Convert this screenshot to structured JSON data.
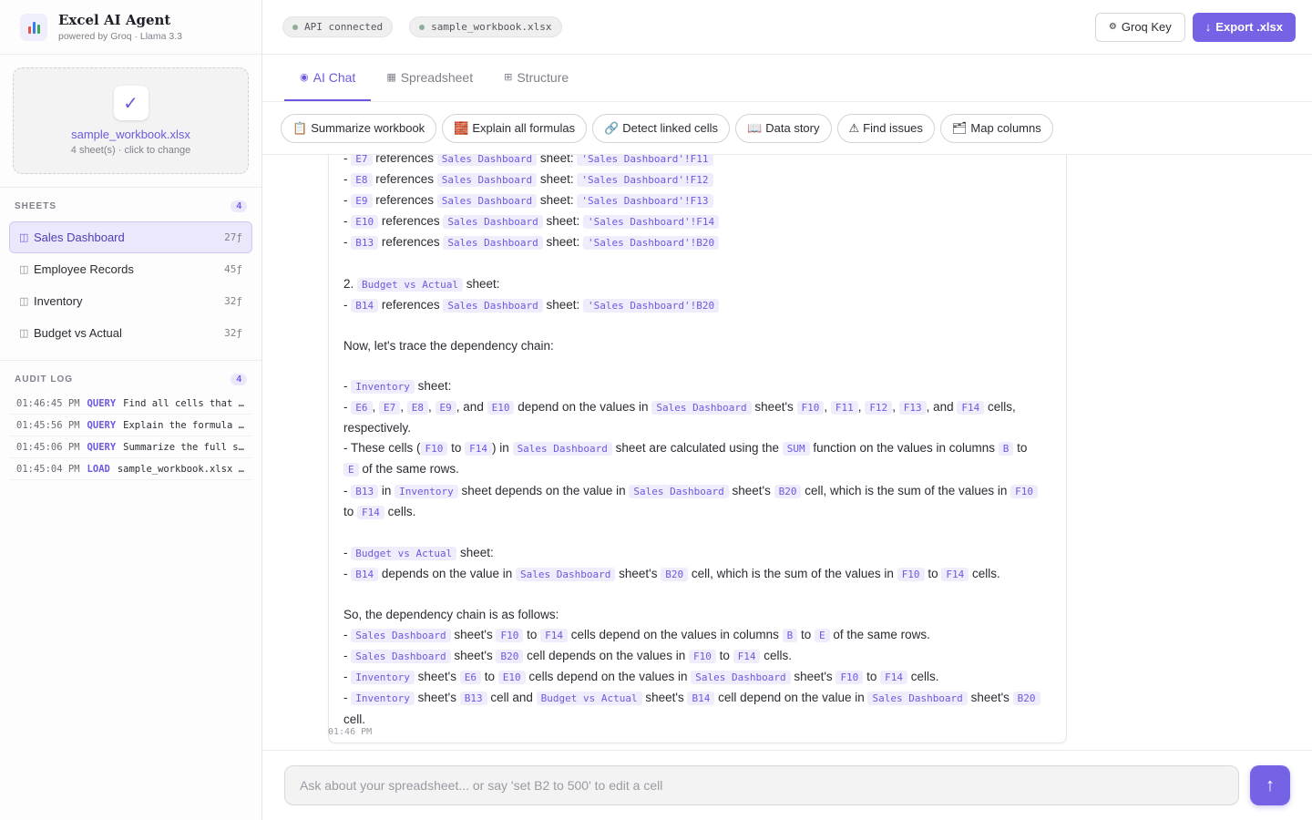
{
  "brand": {
    "title": "Excel AI Agent",
    "subtitle": "powered by Groq · Llama 3.3"
  },
  "upload": {
    "filename": "sample_workbook.xlsx",
    "hint": "4 sheet(s) · click to change"
  },
  "sheets": {
    "header": "SHEETS",
    "count": "4",
    "items": [
      {
        "name": "Sales Dashboard",
        "formulas": "27ƒ",
        "active": true
      },
      {
        "name": "Employee Records",
        "formulas": "45ƒ"
      },
      {
        "name": "Inventory",
        "formulas": "32ƒ"
      },
      {
        "name": "Budget vs Actual",
        "formulas": "32ƒ"
      }
    ]
  },
  "audit": {
    "header": "AUDIT LOG",
    "count": "4",
    "rows": [
      {
        "time": "01:46:45 PM",
        "kind": "QUERY",
        "msg": "Find all cells that re…"
      },
      {
        "time": "01:45:56 PM",
        "kind": "QUERY",
        "msg": "Explain the formula in…"
      },
      {
        "time": "01:45:06 PM",
        "kind": "QUERY",
        "msg": "Summarize the full str…"
      },
      {
        "time": "01:45:04 PM",
        "kind": "LOAD",
        "msg": "sample_workbook.xlsx — …"
      }
    ]
  },
  "topbar": {
    "api_status": "API connected",
    "file_pill": "sample_workbook.xlsx",
    "groq_key": "Groq Key",
    "export": "Export .xlsx"
  },
  "tabs": [
    {
      "label": "AI Chat",
      "icon": "◉",
      "active": true
    },
    {
      "label": "Spreadsheet",
      "icon": "▦"
    },
    {
      "label": "Structure",
      "icon": "⊞"
    }
  ],
  "quick_actions": [
    {
      "icon": "📋",
      "label": "Summarize workbook"
    },
    {
      "icon": "🧱",
      "label": "Explain all formulas"
    },
    {
      "icon": "🔗",
      "label": "Detect linked cells"
    },
    {
      "icon": "📖",
      "label": "Data story"
    },
    {
      "icon": "⚠",
      "label": "Find issues"
    },
    {
      "icon": "🗂",
      "label": "Map columns"
    }
  ],
  "message": {
    "timestamp": "01:46 PM",
    "lines": [
      [
        {
          "t": "- "
        },
        {
          "c": "E7"
        },
        {
          "t": " references "
        },
        {
          "c": "Sales Dashboard"
        },
        {
          "t": " sheet: "
        },
        {
          "c": "'Sales Dashboard'!F11"
        }
      ],
      [
        {
          "t": "- "
        },
        {
          "c": "E8"
        },
        {
          "t": " references "
        },
        {
          "c": "Sales Dashboard"
        },
        {
          "t": " sheet: "
        },
        {
          "c": "'Sales Dashboard'!F12"
        }
      ],
      [
        {
          "t": "- "
        },
        {
          "c": "E9"
        },
        {
          "t": " references "
        },
        {
          "c": "Sales Dashboard"
        },
        {
          "t": " sheet: "
        },
        {
          "c": "'Sales Dashboard'!F13"
        }
      ],
      [
        {
          "t": "- "
        },
        {
          "c": "E10"
        },
        {
          "t": " references "
        },
        {
          "c": "Sales Dashboard"
        },
        {
          "t": " sheet: "
        },
        {
          "c": "'Sales Dashboard'!F14"
        }
      ],
      [
        {
          "t": "- "
        },
        {
          "c": "B13"
        },
        {
          "t": " references "
        },
        {
          "c": "Sales Dashboard"
        },
        {
          "t": " sheet: "
        },
        {
          "c": "'Sales Dashboard'!B20"
        }
      ],
      [],
      [
        {
          "t": "2. "
        },
        {
          "c": "Budget vs Actual"
        },
        {
          "t": " sheet:"
        }
      ],
      [
        {
          "t": "- "
        },
        {
          "c": "B14"
        },
        {
          "t": " references "
        },
        {
          "c": "Sales Dashboard"
        },
        {
          "t": " sheet: "
        },
        {
          "c": "'Sales Dashboard'!B20"
        }
      ],
      [],
      [
        {
          "t": "Now, let's trace the dependency chain:"
        }
      ],
      [],
      [
        {
          "t": "- "
        },
        {
          "c": "Inventory"
        },
        {
          "t": " sheet:"
        }
      ],
      [
        {
          "t": "- "
        },
        {
          "c": "E6"
        },
        {
          "t": ", "
        },
        {
          "c": "E7"
        },
        {
          "t": ", "
        },
        {
          "c": "E8"
        },
        {
          "t": ", "
        },
        {
          "c": "E9"
        },
        {
          "t": ", and "
        },
        {
          "c": "E10"
        },
        {
          "t": " depend on the values in "
        },
        {
          "c": "Sales Dashboard"
        },
        {
          "t": " sheet's "
        },
        {
          "c": "F10"
        },
        {
          "t": ", "
        },
        {
          "c": "F11"
        },
        {
          "t": ", "
        },
        {
          "c": "F12"
        },
        {
          "t": ", "
        },
        {
          "c": "F13"
        },
        {
          "t": ", and "
        },
        {
          "c": "F14"
        },
        {
          "t": " cells,"
        }
      ],
      [
        {
          "t": "respectively."
        }
      ],
      [
        {
          "t": "- These cells ("
        },
        {
          "c": "F10"
        },
        {
          "t": " to "
        },
        {
          "c": "F14"
        },
        {
          "t": ") in "
        },
        {
          "c": "Sales Dashboard"
        },
        {
          "t": " sheet are calculated using the "
        },
        {
          "c": "SUM"
        },
        {
          "t": " function on the values in columns "
        },
        {
          "c": "B"
        },
        {
          "t": " to"
        }
      ],
      [
        {
          "c": "E"
        },
        {
          "t": " of the same rows."
        }
      ],
      [
        {
          "t": "- "
        },
        {
          "c": "B13"
        },
        {
          "t": " in "
        },
        {
          "c": "Inventory"
        },
        {
          "t": " sheet depends on the value in "
        },
        {
          "c": "Sales Dashboard"
        },
        {
          "t": " sheet's "
        },
        {
          "c": "B20"
        },
        {
          "t": " cell, which is the sum of the values in "
        },
        {
          "c": "F10"
        }
      ],
      [
        {
          "t": "to "
        },
        {
          "c": "F14"
        },
        {
          "t": " cells."
        }
      ],
      [],
      [
        {
          "t": "- "
        },
        {
          "c": "Budget vs Actual"
        },
        {
          "t": " sheet:"
        }
      ],
      [
        {
          "t": "- "
        },
        {
          "c": "B14"
        },
        {
          "t": " depends on the value in "
        },
        {
          "c": "Sales Dashboard"
        },
        {
          "t": " sheet's "
        },
        {
          "c": "B20"
        },
        {
          "t": " cell, which is the sum of the values in "
        },
        {
          "c": "F10"
        },
        {
          "t": " to "
        },
        {
          "c": "F14"
        },
        {
          "t": " cells."
        }
      ],
      [],
      [
        {
          "t": "So, the dependency chain is as follows:"
        }
      ],
      [
        {
          "t": "- "
        },
        {
          "c": "Sales Dashboard"
        },
        {
          "t": " sheet's "
        },
        {
          "c": "F10"
        },
        {
          "t": " to "
        },
        {
          "c": "F14"
        },
        {
          "t": " cells depend on the values in columns "
        },
        {
          "c": "B"
        },
        {
          "t": " to "
        },
        {
          "c": "E"
        },
        {
          "t": " of the same rows."
        }
      ],
      [
        {
          "t": "- "
        },
        {
          "c": "Sales Dashboard"
        },
        {
          "t": " sheet's "
        },
        {
          "c": "B20"
        },
        {
          "t": " cell depends on the values in "
        },
        {
          "c": "F10"
        },
        {
          "t": " to "
        },
        {
          "c": "F14"
        },
        {
          "t": " cells."
        }
      ],
      [
        {
          "t": "- "
        },
        {
          "c": "Inventory"
        },
        {
          "t": " sheet's "
        },
        {
          "c": "E6"
        },
        {
          "t": " to "
        },
        {
          "c": "E10"
        },
        {
          "t": " cells depend on the values in "
        },
        {
          "c": "Sales Dashboard"
        },
        {
          "t": " sheet's "
        },
        {
          "c": "F10"
        },
        {
          "t": " to "
        },
        {
          "c": "F14"
        },
        {
          "t": " cells."
        }
      ],
      [
        {
          "t": "- "
        },
        {
          "c": "Inventory"
        },
        {
          "t": " sheet's "
        },
        {
          "c": "B13"
        },
        {
          "t": " cell and "
        },
        {
          "c": "Budget vs Actual"
        },
        {
          "t": " sheet's "
        },
        {
          "c": "B14"
        },
        {
          "t": " cell depend on the value in "
        },
        {
          "c": "Sales Dashboard"
        },
        {
          "t": " sheet's "
        },
        {
          "c": "B20"
        }
      ],
      [
        {
          "t": "cell."
        }
      ]
    ]
  },
  "composer": {
    "placeholder": "Ask about your spreadsheet... or say 'set B2 to 500' to edit a cell",
    "send_icon": "↑"
  },
  "colors": {
    "accent": "#7563e6",
    "accent_text": "#6b5ae0",
    "code_bg": "#efedfb",
    "active_bg": "#ebe8fc"
  }
}
